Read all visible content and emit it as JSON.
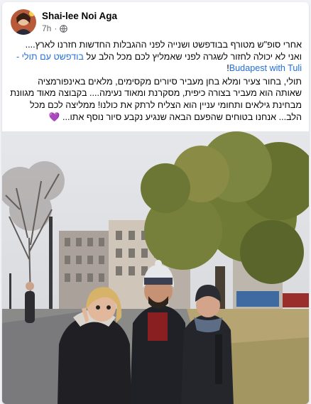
{
  "post": {
    "author": "Shai-lee Noi Aga",
    "timestamp": "7h",
    "separator": "·",
    "audience_icon": "globe-icon",
    "paragraph1_a": "אחרי סופ\"ש מטורף בבודפשט ושנייה לפני ההגבלות החדשות חזרנו לארץ.... ואני לא יכולה לחזור לשגרה לפני שאמליץ לכם מכל הלב על ",
    "paragraph1_link": "בודפשט עם תולי - Budapest with Tuli",
    "paragraph1_end": "!",
    "paragraph2": "תולי, בחור צעיר ומלא בחן מעביר סיורים מקסימים, מלאים באינפורמציה שאותה הוא מעביר בצורה כיפית, מסקרנת ומאוד נעימה.... בקבוצה מאוד מגוונת מבחינת גילאים ותחומי עניין הוא הצליח לרתק את כולנו! ממליצה לכם מכל הלב... אנחנו בטוחים שהפעם הבאה שנגיע נקבע סיור נוסף אתו...",
    "emoji": "💜"
  },
  "colors": {
    "link": "#216fdb",
    "text": "#050505",
    "secondary": "#65676b"
  }
}
